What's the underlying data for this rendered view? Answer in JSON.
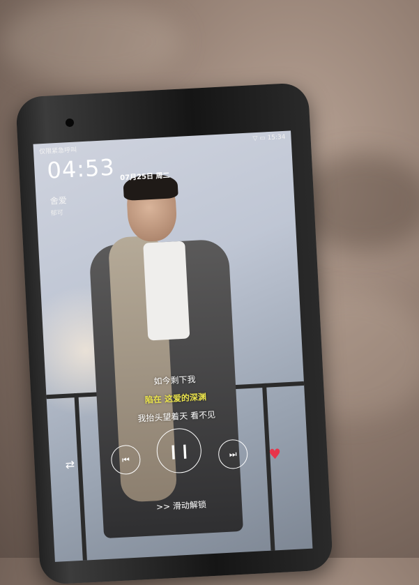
{
  "status": {
    "left": "仅限紧急呼叫",
    "right": "▽ ▭ 15:34"
  },
  "lockscreen": {
    "time": "04:53",
    "date": "07月25日 周二",
    "song_title": "舍爱",
    "artist": "郁可"
  },
  "lyrics": [
    "如今剩下我",
    "陷在 这爱的深渊",
    "我抬头望着天 看不见"
  ],
  "controls": {
    "shuffle": "⇄",
    "prev": "⏮",
    "play": "❙❙",
    "next": "⏭",
    "like": "♥"
  },
  "unlock_hint": ">> 滑动解锁",
  "colors": {
    "highlight_lyric": "#e9e24b",
    "like": "#e8344a"
  }
}
